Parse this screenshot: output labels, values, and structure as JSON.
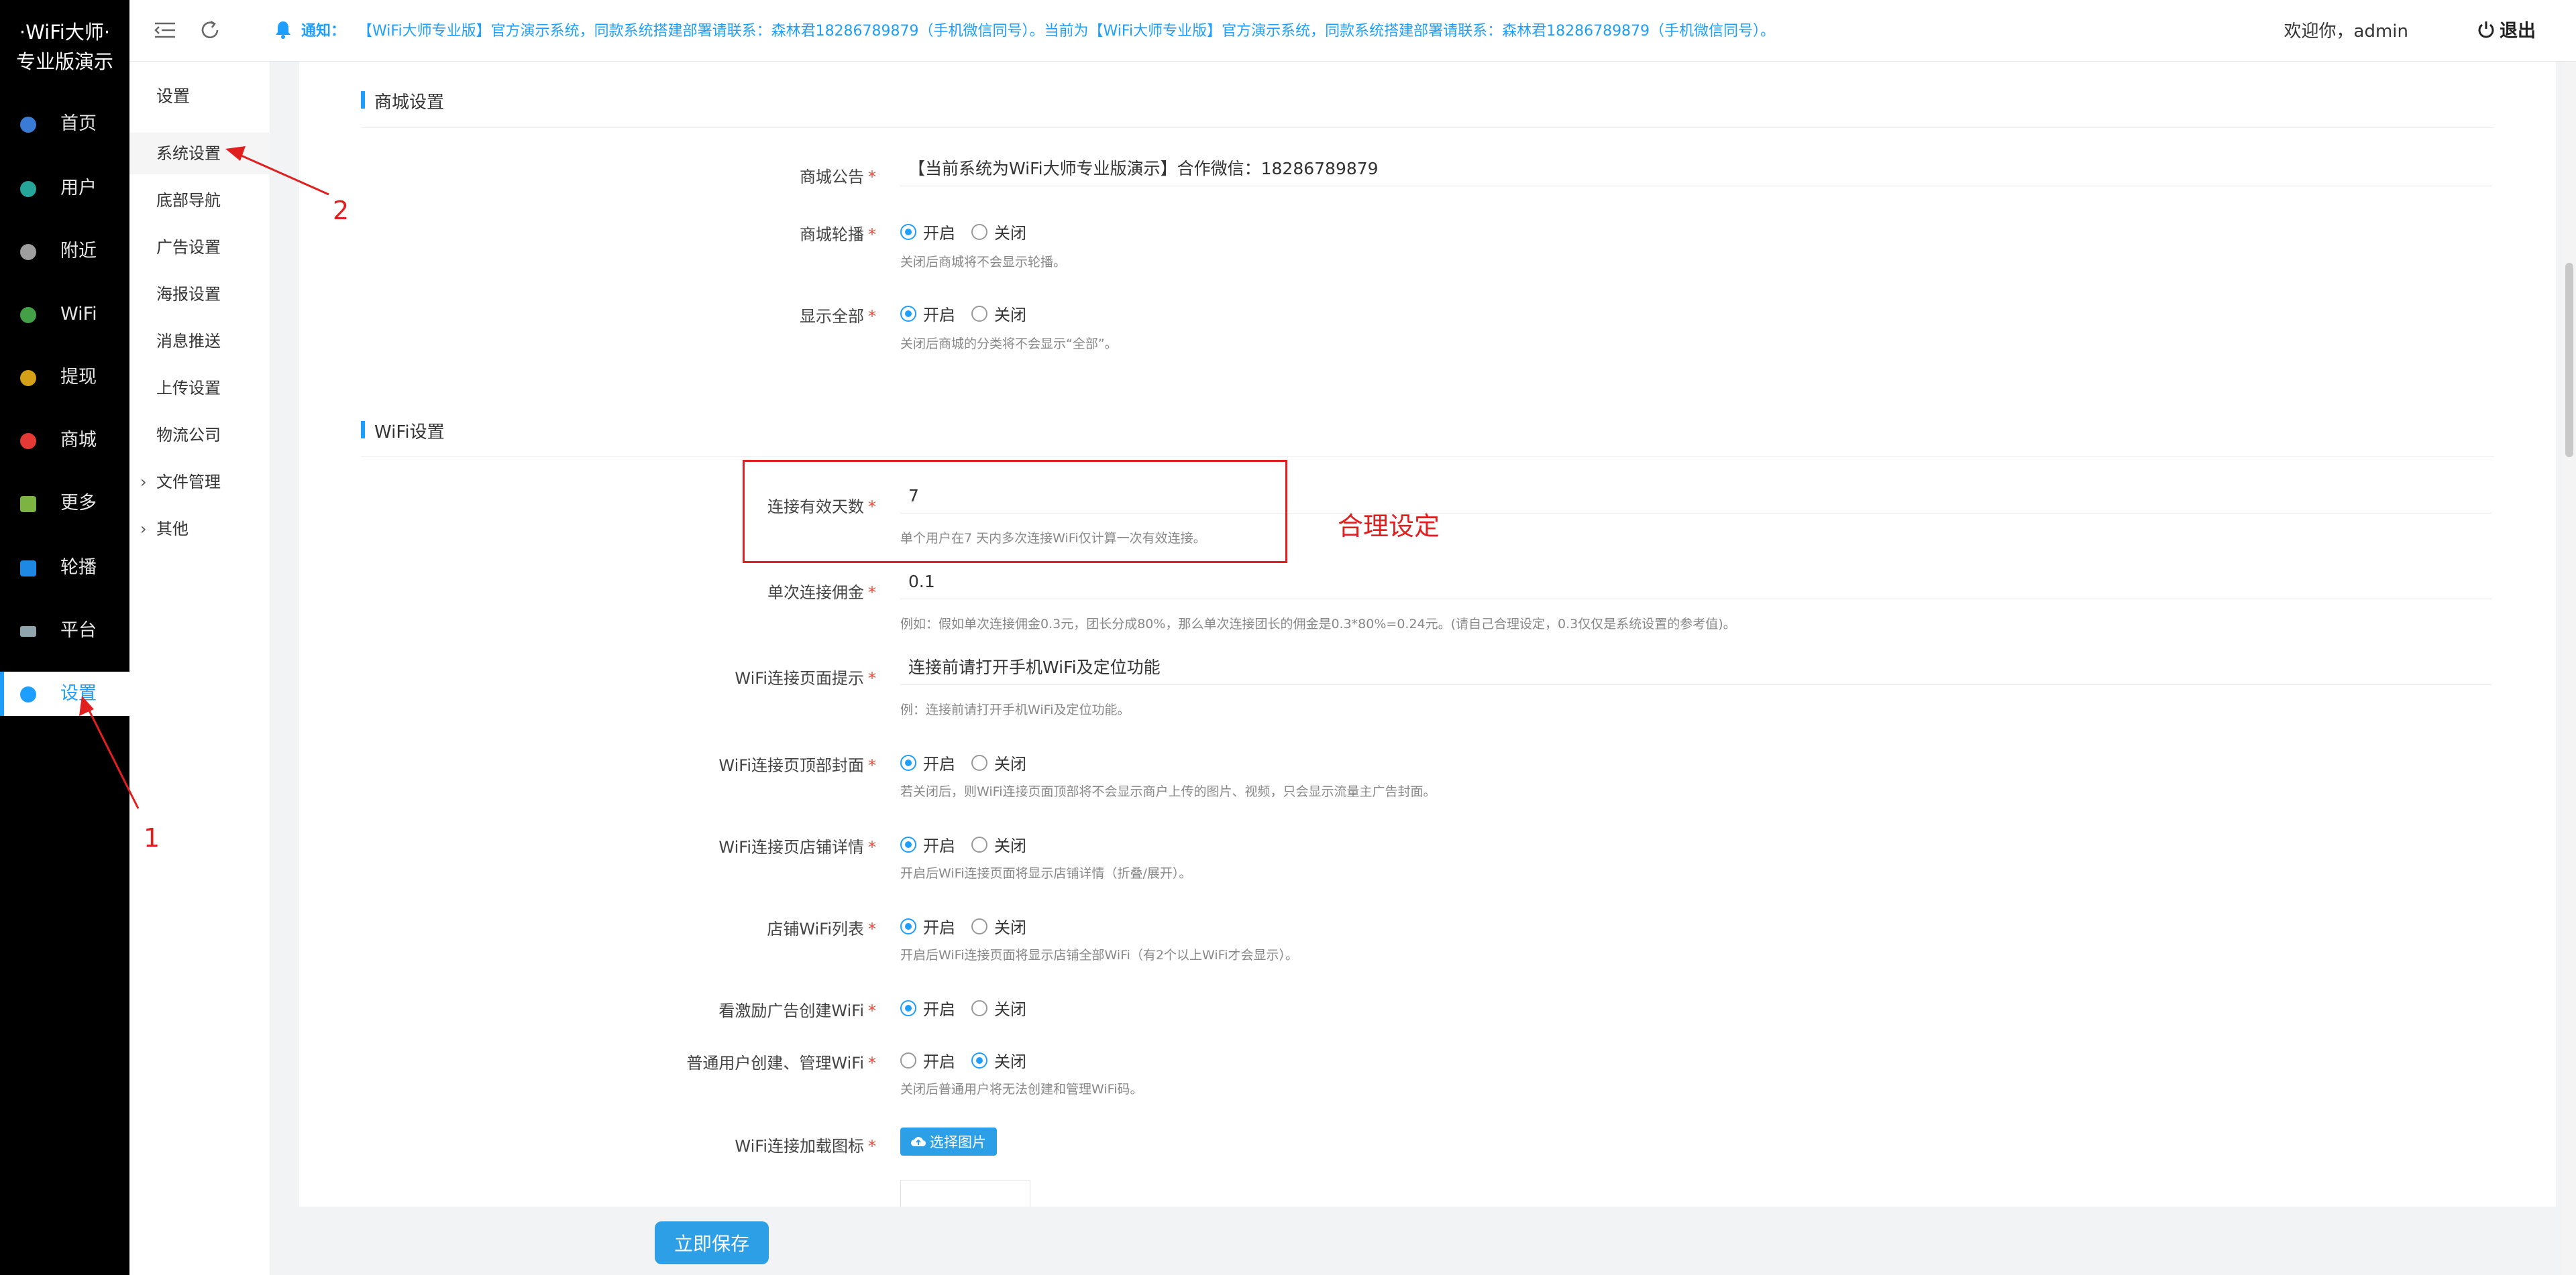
{
  "brand": {
    "line1": "·WiFi大师·",
    "line2": "专业版演示"
  },
  "sidebar": {
    "items": [
      {
        "label": "首页",
        "icon": "home-icon",
        "color": "#3a7bd5"
      },
      {
        "label": "用户",
        "icon": "user-icon",
        "color": "#26a69a"
      },
      {
        "label": "附近",
        "icon": "location-icon",
        "color": "#9e9e9e"
      },
      {
        "label": "WiFi",
        "icon": "wifi-icon",
        "color": "#43a047"
      },
      {
        "label": "提现",
        "icon": "coin-icon",
        "color": "#d4a017"
      },
      {
        "label": "商城",
        "icon": "shop-icon",
        "color": "#e53935"
      },
      {
        "label": "更多",
        "icon": "grid-icon",
        "color": "#7cb342"
      },
      {
        "label": "轮播",
        "icon": "carousel-icon",
        "color": "#1e88e5"
      },
      {
        "label": "平台",
        "icon": "monitor-icon",
        "color": "#90a4ae"
      },
      {
        "label": "设置",
        "icon": "settings-icon",
        "color": "#1e9fff"
      }
    ]
  },
  "submenu": {
    "title": "设置",
    "items": [
      "系统设置",
      "底部导航",
      "广告设置",
      "海报设置",
      "消息推送",
      "上传设置",
      "物流公司"
    ],
    "groups": [
      "文件管理",
      "其他"
    ]
  },
  "header": {
    "notice_label": "通知：",
    "notice_text": "【WiFi大师专业版】官方演示系统，同款系统搭建部署请联系：森林君18286789879（手机微信同号）。当前为【WiFi大师专业版】官方演示系统，同款系统搭建部署请联系：森林君18286789879（手机微信同号）。",
    "welcome": "欢迎你，admin",
    "logout": "退出"
  },
  "shop_section": {
    "title": "商城设置",
    "announcement": {
      "label": "商城公告",
      "value": "【当前系统为WiFi大师专业版演示】合作微信：18286789879"
    },
    "carousel": {
      "label": "商城轮播",
      "hint": "关闭后商城将不会显示轮播。",
      "selected": "开启"
    },
    "show_all": {
      "label": "显示全部",
      "hint": "关闭后商城的分类将不会显示“全部”。",
      "selected": "开启"
    }
  },
  "wifi_section": {
    "title": "WiFi设置",
    "valid_days": {
      "label": "连接有效天数",
      "value": "7",
      "hint": "单个用户在7 天内多次连接WiFi仅计算一次有效连接。"
    },
    "commission": {
      "label": "单次连接佣金",
      "value": "0.1",
      "hint": "例如：假如单次连接佣金0.3元，团长分成80%，那么单次连接团长的佣金是0.3*80%=0.24元。(请自己合理设定，0.3仅仅是系统设置的参考值)。"
    },
    "page_tip": {
      "label": "WiFi连接页面提示",
      "value": "连接前请打开手机WiFi及定位功能",
      "hint": "例：连接前请打开手机WiFi及定位功能。"
    },
    "top_cover": {
      "label": "WiFi连接页顶部封面",
      "hint": "若关闭后，则WiFi连接页面顶部将不会显示商户上传的图片、视频，只会显示流量主广告封面。",
      "selected": "开启"
    },
    "store_detail": {
      "label": "WiFi连接页店铺详情",
      "hint": "开启后WiFi连接页面将显示店铺详情（折叠/展开）。",
      "selected": "开启"
    },
    "store_list": {
      "label": "店铺WiFi列表",
      "hint": "开启后WiFi连接页面将显示店铺全部WiFi（有2个以上WiFi才会显示）。",
      "selected": "开启"
    },
    "ad_create": {
      "label": "看激励广告创建WiFi",
      "selected": "开启"
    },
    "user_manage": {
      "label": "普通用户创建、管理WiFi",
      "hint": "关闭后普通用户将无法创建和管理WiFi码。",
      "selected": "关闭"
    },
    "loading_icon": {
      "label": "WiFi连接加载图标",
      "button": "选择图片"
    }
  },
  "radio_options": {
    "on": "开启",
    "off": "关闭"
  },
  "required_mark": "*",
  "save_button": "立即保存",
  "annotations": {
    "box_text": "合理设定",
    "num1": "1",
    "num2": "2",
    "color": "#e02020"
  }
}
